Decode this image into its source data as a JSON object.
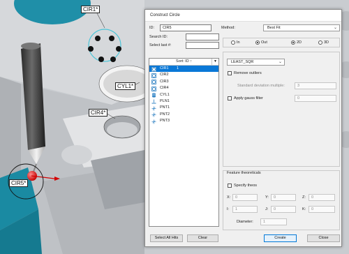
{
  "viewport": {
    "labels": {
      "cir1": "CIR1*",
      "cyl1": "CYL1*",
      "cir4": "CIR4*",
      "cir5": "CIR5*"
    }
  },
  "dialog": {
    "title": "Construct Circle",
    "id_label": "ID:",
    "id_value": "CIR5",
    "search_id_label": "Search ID:",
    "search_id_value": "",
    "select_last_label": "Select last #:",
    "select_last_value": "",
    "method_label": "Method:",
    "method_value": "Best Fit",
    "list_header": "Sort: ID ↑",
    "list_items": [
      {
        "label": "CIR1",
        "hits": "1",
        "icon": "circle-icon"
      },
      {
        "label": "CIR2",
        "hits": "",
        "icon": "circle-icon"
      },
      {
        "label": "CIR3",
        "hits": "",
        "icon": "circle-icon"
      },
      {
        "label": "CIR4",
        "hits": "",
        "icon": "circle-icon"
      },
      {
        "label": "CYL1",
        "hits": "",
        "icon": "cylinder-icon"
      },
      {
        "label": "PLN1",
        "hits": "",
        "icon": "plane-icon"
      },
      {
        "label": "PNT1",
        "hits": "",
        "icon": "point-icon"
      },
      {
        "label": "PNT2",
        "hits": "",
        "icon": "point-icon"
      },
      {
        "label": "PNT3",
        "hits": "",
        "icon": "point-icon"
      }
    ],
    "direction": {
      "in": "In",
      "out": "Out",
      "selected": "Out"
    },
    "projection": {
      "d2": "2D",
      "d3": "3D",
      "selected": "2D"
    },
    "algorithm": "LEAST_SQR",
    "remove_outliers": "Remove outliers",
    "std_dev_label": "Standard deviation multiple:",
    "std_dev_value": "3",
    "gauss_label": "Apply gauss filter",
    "gauss_value": "0",
    "feature_theoreticals": "Feature theoreticals",
    "specify_theos": "Specify theos",
    "theo": {
      "x_label": "X:",
      "x": "0",
      "y_label": "Y:",
      "y": "0",
      "z_label": "Z:",
      "z": "0",
      "i_label": "I:",
      "i": "1",
      "j_label": "J:",
      "j": "0",
      "k_label": "K:",
      "k": "0",
      "diameter_label": "Diameter:",
      "diameter": "1"
    },
    "buttons": {
      "select_all_hits": "Select All Hits",
      "clear": "Clear",
      "create": "Create",
      "close": "Close"
    },
    "accent_color": "#0a78d7"
  }
}
